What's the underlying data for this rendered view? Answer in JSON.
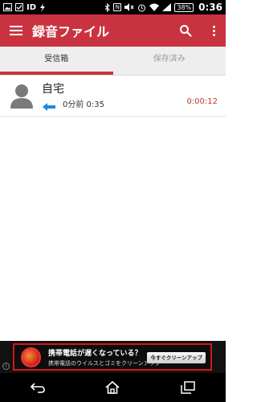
{
  "status_bar": {
    "id_label": "ID",
    "nfc_label": "N",
    "battery": "38%",
    "time": "0:36"
  },
  "app_bar": {
    "title": "録音ファイル"
  },
  "tabs": [
    {
      "label": "受信箱",
      "active": true
    },
    {
      "label": "保存済み",
      "active": false
    }
  ],
  "calls": [
    {
      "name": "自宅",
      "meta": "0分前 0:35",
      "duration": "0:00:12",
      "direction": "incoming"
    }
  ],
  "ad": {
    "title": "携帯電話が遅くなっている？",
    "subtitle": "携帯電話のウイルスとゴミをクリーンアップ",
    "cta": "今すぐクリーンアップ",
    "info": "i"
  },
  "colors": {
    "accent": "#c93340",
    "duration": "#c0392b",
    "arrow": "#1e88e5"
  }
}
